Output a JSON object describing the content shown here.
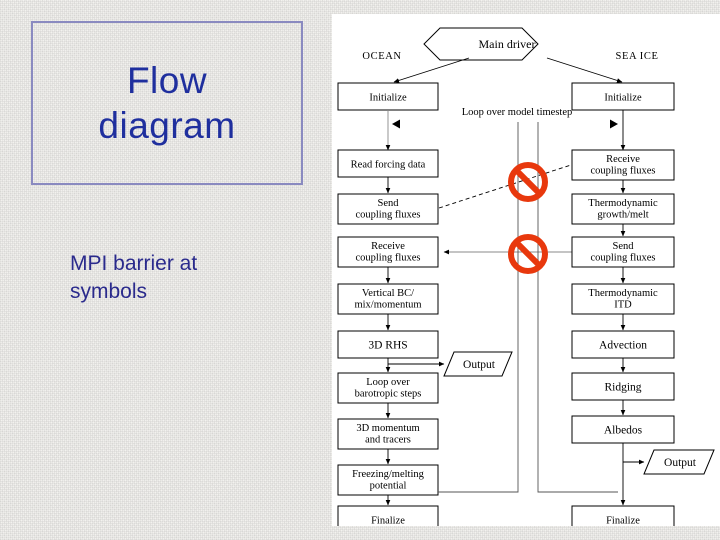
{
  "slide": {
    "title": "Flow\ndiagram",
    "subtitle": "MPI barrier at\nsymbols",
    "title_color": "#1f2f9e",
    "title_border_color": "#8a8ac0",
    "background_color": "#f3f2ef"
  },
  "diagram": {
    "background_color": "#ffffff",
    "stroke_color": "#000000",
    "barrier_color": "#e8380d",
    "root": {
      "label": "Main driver",
      "shape": "hexagon"
    },
    "branch_labels": {
      "left": "OCEAN",
      "right": "SEA ICE"
    },
    "loop_label": "Loop over model timestep",
    "left_column": [
      {
        "label": "Initialize",
        "shape": "box"
      },
      {
        "label": "Read forcing data",
        "shape": "box"
      },
      {
        "label": "Send\ncoupling fluxes",
        "shape": "box"
      },
      {
        "label": "Receive\ncoupling fluxes",
        "shape": "box"
      },
      {
        "label": "Vertical BC/\nmix/momentum",
        "shape": "box"
      },
      {
        "label": "3D RHS",
        "shape": "box"
      },
      {
        "label": "Loop over\nbarotropic steps",
        "shape": "box"
      },
      {
        "label": "3D momentum\nand tracers",
        "shape": "box"
      },
      {
        "label": "Freezing/melting\npotential",
        "shape": "box"
      },
      {
        "label": "Finalize",
        "shape": "box"
      }
    ],
    "right_column": [
      {
        "label": "Initialize",
        "shape": "box"
      },
      {
        "label": "Receive\ncoupling fluxes",
        "shape": "box"
      },
      {
        "label": "Thermodynamic\ngrowth/melt",
        "shape": "box"
      },
      {
        "label": "Send\ncoupling fluxes",
        "shape": "box"
      },
      {
        "label": "Thermodynamic\nITD",
        "shape": "box"
      },
      {
        "label": "Advection",
        "shape": "box"
      },
      {
        "label": "Ridging",
        "shape": "box"
      },
      {
        "label": "Albedos",
        "shape": "box"
      },
      {
        "label": "Finalize",
        "shape": "box"
      }
    ],
    "outputs": [
      {
        "label": "Output",
        "shape": "parallelogram",
        "side": "left"
      },
      {
        "label": "Output",
        "shape": "parallelogram",
        "side": "right"
      }
    ],
    "barriers": [
      {
        "name": "mpi-barrier-upper",
        "symbol": "no-entry"
      },
      {
        "name": "mpi-barrier-lower",
        "symbol": "no-entry"
      }
    ]
  }
}
